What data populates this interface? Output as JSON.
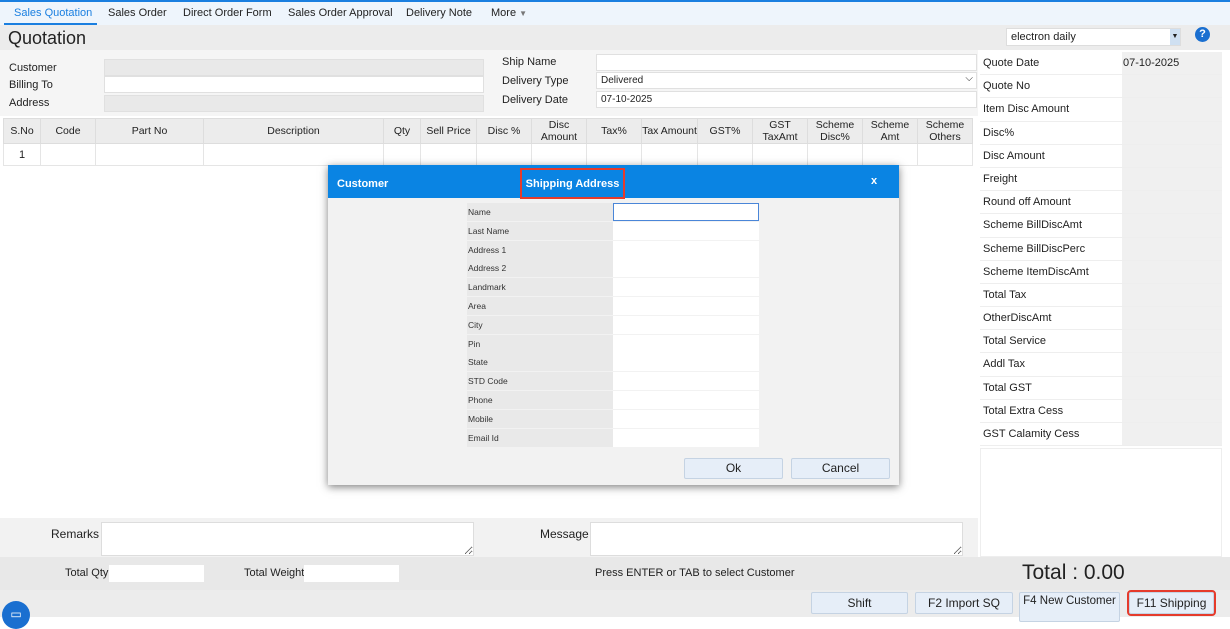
{
  "tabs": [
    "Sales Quotation",
    "Sales Order",
    "Direct Order Form",
    "Sales Order Approval",
    "Delivery Note",
    "More"
  ],
  "title": "Quotation",
  "company": "electron daily",
  "help": "?",
  "form": {
    "customer": "Customer",
    "billing_to": "Billing To",
    "address": "Address",
    "ship_name": "Ship Name",
    "delivery_type": "Delivery Type",
    "delivery_type_value": "Delivered",
    "delivery_date": "Delivery Date",
    "delivery_date_value": "07-10-2025"
  },
  "table": {
    "headers": [
      "S.No",
      "Code",
      "Part No",
      "Description",
      "Qty",
      "Sell Price",
      "Disc %",
      "Disc Amount",
      "Tax%",
      "Tax Amount",
      "GST%",
      "GST TaxAmt",
      "Scheme Disc%",
      "Scheme Amt",
      "Scheme Others"
    ],
    "rows": [
      [
        "1",
        "",
        "",
        "",
        "",
        "",
        "",
        "",
        "",
        "",
        "",
        "",
        "",
        "",
        ""
      ]
    ]
  },
  "summary": [
    {
      "k": "Quote Date",
      "v": "07-10-2025"
    },
    {
      "k": "Quote No",
      "v": ""
    },
    {
      "k": "Item Disc Amount",
      "v": ""
    },
    {
      "k": "Disc%",
      "v": ""
    },
    {
      "k": "Disc Amount",
      "v": ""
    },
    {
      "k": "Freight",
      "v": ""
    },
    {
      "k": "Round off Amount",
      "v": ""
    },
    {
      "k": "Scheme BillDiscAmt",
      "v": ""
    },
    {
      "k": "Scheme BillDiscPerc",
      "v": ""
    },
    {
      "k": "Scheme ItemDiscAmt",
      "v": ""
    },
    {
      "k": "Total Tax",
      "v": ""
    },
    {
      "k": "OtherDiscAmt",
      "v": ""
    },
    {
      "k": "Total Service",
      "v": ""
    },
    {
      "k": "Addl Tax",
      "v": ""
    },
    {
      "k": "Total GST",
      "v": ""
    },
    {
      "k": "Total Extra Cess",
      "v": ""
    },
    {
      "k": "GST Calamity Cess",
      "v": ""
    }
  ],
  "dialog": {
    "tab_customer": "Customer",
    "tab_shipping": "Shipping Address",
    "close": "x",
    "fields": [
      "Name",
      "Last Name",
      "Address 1",
      "Address 2",
      "Landmark",
      "Area",
      "City",
      "Pin",
      "State",
      "STD Code",
      "Phone",
      "Mobile",
      "Email Id"
    ],
    "ok": "Ok",
    "cancel": "Cancel"
  },
  "bottom": {
    "remarks": "Remarks",
    "message": "Message",
    "total_qty": "Total Qty",
    "total_weight": "Total Weight",
    "hint": "Press ENTER or TAB to select Customer",
    "total": "Total : 0.00"
  },
  "buttons": {
    "shift": "Shift",
    "import": "F2 Import SQ",
    "new_customer": "F4 New Customer",
    "shipping": "F11 Shipping"
  }
}
